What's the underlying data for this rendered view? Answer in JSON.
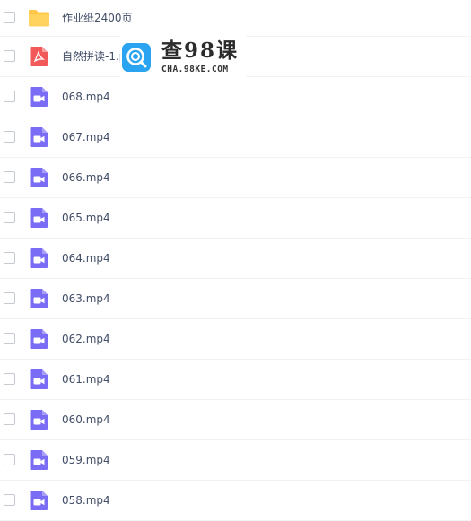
{
  "files": [
    {
      "name": "作业纸2400页",
      "icon": "folder-icon"
    },
    {
      "name": "自然拼读-1.pdf",
      "icon": "pdf-icon"
    },
    {
      "name": "068.mp4",
      "icon": "video-file-icon"
    },
    {
      "name": "067.mp4",
      "icon": "video-file-icon"
    },
    {
      "name": "066.mp4",
      "icon": "video-file-icon"
    },
    {
      "name": "065.mp4",
      "icon": "video-file-icon"
    },
    {
      "name": "064.mp4",
      "icon": "video-file-icon"
    },
    {
      "name": "063.mp4",
      "icon": "video-file-icon"
    },
    {
      "name": "062.mp4",
      "icon": "video-file-icon"
    },
    {
      "name": "061.mp4",
      "icon": "video-file-icon"
    },
    {
      "name": "060.mp4",
      "icon": "video-file-icon"
    },
    {
      "name": "059.mp4",
      "icon": "video-file-icon"
    },
    {
      "name": "058.mp4",
      "icon": "video-file-icon"
    }
  ],
  "watermark": {
    "title": "查98课",
    "subtitle": "CHA.98KE.COM",
    "icon": "search-magnifier-logo-icon"
  },
  "colors": {
    "folder": "#ffc84a",
    "pdf": "#f25a5a",
    "video": "#7b6cf6",
    "text": "#424e67",
    "divider": "#f1f2f4",
    "watermark_logo": "#2aa3f0"
  }
}
